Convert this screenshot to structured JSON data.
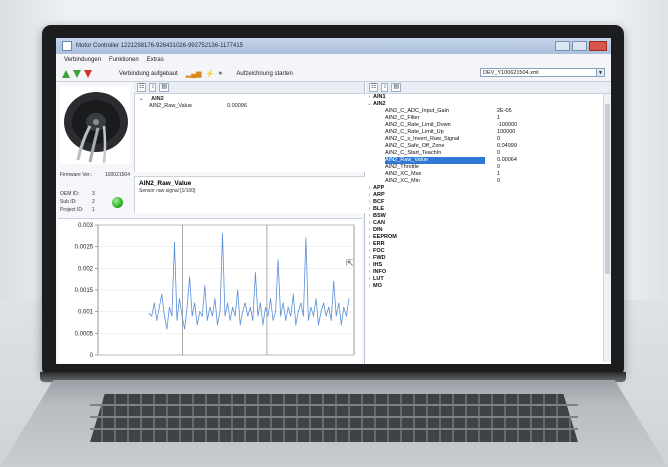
{
  "window": {
    "title": "Motor Controller 1221298176-926431026-992752136-1177415",
    "menu": [
      "Verbindungen",
      "Funktionen",
      "Extras"
    ],
    "toolbar": {
      "connection_status": "Verbindung aufgebaut",
      "record_label": "Aufzeichnung starten",
      "file_combo": "DEV_Y100621504.xml"
    }
  },
  "device": {
    "firmware_label": "Firmware Ver.:",
    "firmware_value": "100021504",
    "oem_label": "OEM ID:",
    "oem_value": "3",
    "sub_label": "Sub ID:",
    "sub_value": "2",
    "project_label": "Project ID:",
    "project_value": "1",
    "status_color": "#2fb12a"
  },
  "left_tree": {
    "group": "AIN2",
    "item_name": "AIN2_Raw_Value",
    "item_value": "0.00096"
  },
  "description": {
    "title": "AIN2_Raw_Value",
    "subtitle": "Sensor raw signal [1/100]"
  },
  "chart_data": {
    "type": "line",
    "title": "",
    "xlabel": "",
    "ylabel": "",
    "ylim": [
      0,
      0.003
    ],
    "yticks": [
      "0",
      "0.0005",
      "0.001",
      "0.0015",
      "0.002",
      "0.0025",
      "0.003"
    ],
    "grid": true,
    "color": "#5b8fd8",
    "values": [
      0.00096,
      0.0009,
      0.0012,
      0.0008,
      0.0011,
      0.0014,
      0.0009,
      0.0006,
      0.0011,
      0.0009,
      0.0026,
      0.0008,
      0.0013,
      0.0009,
      0.0006,
      0.0011,
      0.0018,
      0.0009,
      0.0012,
      0.0007,
      0.001,
      0.0009,
      0.0016,
      0.0008,
      0.0011,
      0.0009,
      0.0013,
      0.0007,
      0.001,
      0.0028,
      0.0009,
      0.0012,
      0.0008,
      0.0011,
      0.0009,
      0.0015,
      0.0007,
      0.001,
      0.0012,
      0.0009,
      0.0011,
      0.0008,
      0.0019,
      0.0009,
      0.0012,
      0.0007,
      0.0011,
      0.0009,
      0.0013,
      0.0008,
      0.001,
      0.0022,
      0.0009,
      0.0012,
      0.0008,
      0.0011,
      0.0009,
      0.0014,
      0.0007,
      0.001,
      0.0012,
      0.0009,
      0.0027,
      0.0008,
      0.0011,
      0.0009,
      0.0013,
      0.0007,
      0.001,
      0.0012,
      0.0009,
      0.0011,
      0.0008,
      0.0017,
      0.0009,
      0.0012,
      0.0007,
      0.0011,
      0.0009,
      0.0013
    ]
  },
  "right_tree": {
    "top_groups": [
      "AIN1",
      "AIN2"
    ],
    "ain2_params": [
      {
        "name": "AIN2_C_ADC_Input_Gain",
        "value": "2E-05"
      },
      {
        "name": "AIN2_C_Filter",
        "value": "1"
      },
      {
        "name": "AIN2_C_Rate_Limit_Down",
        "value": "-100000"
      },
      {
        "name": "AIN2_C_Rate_Limit_Up",
        "value": "100000"
      },
      {
        "name": "AIN2_C_s_Invert_Raw_Signal",
        "value": "0"
      },
      {
        "name": "AIN2_C_Safe_Off_Zone",
        "value": "0.04999"
      },
      {
        "name": "AIN2_C_Start_TeachIn",
        "value": "0"
      },
      {
        "name": "AIN2_Raw_Value",
        "value": "0.00064"
      },
      {
        "name": "AIN2_Throttle",
        "value": "0"
      },
      {
        "name": "AIN2_XC_Max",
        "value": "1"
      },
      {
        "name": "AIN2_XC_Min",
        "value": "0"
      }
    ],
    "other_groups": [
      "APP",
      "ARP",
      "BCF",
      "BLE",
      "BSW",
      "CAN",
      "DIN",
      "EEPROM",
      "ERR",
      "FOC",
      "FWD",
      "IHS",
      "INFO",
      "LUT",
      "MO"
    ]
  }
}
